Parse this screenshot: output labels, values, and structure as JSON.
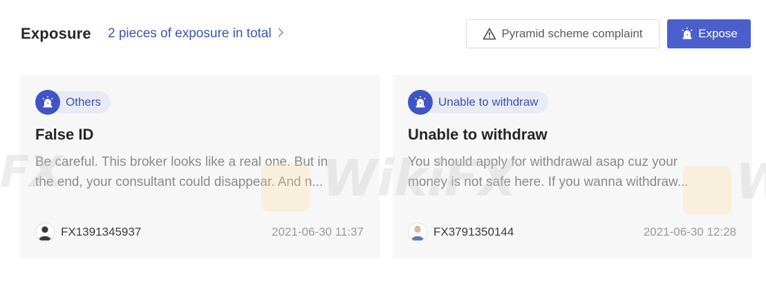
{
  "header": {
    "title": "Exposure",
    "total_link": "2 pieces of exposure in total",
    "complaint_button": "Pyramid scheme complaint",
    "expose_button": "Expose"
  },
  "cards": [
    {
      "tag": "Others",
      "title": "False ID",
      "body_line1": "Be careful. This broker looks like a real one. But in",
      "body_line2": "the end, your consultant could disappear. And n...",
      "author": "FX1391345937",
      "date": "2021-06-30 11:37"
    },
    {
      "tag": "Unable to withdraw",
      "title": "Unable to withdraw",
      "body_line1": "You should apply for withdrawal asap cuz your",
      "body_line2": "money is not safe here. If you wanna withdraw...",
      "author": "FX3791350144",
      "date": "2021-06-30 12:28"
    }
  ],
  "watermark": {
    "brand": "WikiFX",
    "fragment_left": "FX",
    "fragment_right": "W"
  },
  "colors": {
    "accent": "#4a5fcb",
    "link": "#3a55b4",
    "tag_bg": "#e8ebf5",
    "card_bg": "#f7f7f7"
  },
  "icons": {
    "complaint": "warning-triangle-icon",
    "expose": "alarm-light-icon",
    "tag": "alarm-light-icon",
    "link_arrow": "chevron-right-icon",
    "avatar": "user-avatar-icon"
  }
}
